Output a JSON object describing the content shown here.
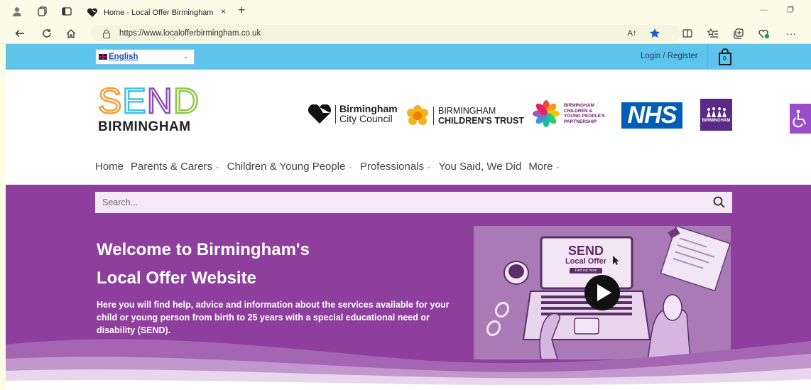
{
  "browser": {
    "tab_title": "Home - Local Offer Birmingham",
    "tab_close": "×",
    "new_tab": "+",
    "url": "https://www.localofferbirmingham.co.uk",
    "reader_label": "A↑"
  },
  "topstrip": {
    "language": "English",
    "login": "Login / Register",
    "cart_count": "0"
  },
  "logo": {
    "letters": [
      "S",
      "E",
      "N",
      "D"
    ],
    "letter_colors": [
      "#f29a2e",
      "#3dbfe6",
      "#8e4db8",
      "#8cc63f"
    ],
    "subtitle": "BIRMINGHAM"
  },
  "partners": {
    "bcc_line1": "Birmingham",
    "bcc_line2": "City Council",
    "bct_line1": "BIRMINGHAM",
    "bct_line2": "CHILDREN'S TRUST",
    "bcyp_lines": [
      "BIRMINGHAM",
      "CHILDREN &",
      "YOUNG PEOPLE'S",
      "PARTNERSHIP"
    ],
    "nhs": "NHS",
    "bpcf": "BIRMINGHAM"
  },
  "nav": {
    "items": [
      {
        "label": "Home",
        "dropdown": false
      },
      {
        "label": "Parents & Carers",
        "dropdown": true
      },
      {
        "label": "Children & Young People",
        "dropdown": true
      },
      {
        "label": "Professionals",
        "dropdown": true
      },
      {
        "label": "You Said, We Did",
        "dropdown": false
      },
      {
        "label": "More",
        "dropdown": true
      }
    ]
  },
  "hero": {
    "search_placeholder": "Search...",
    "title_line1": "Welcome to Birmingham's",
    "title_line2": "Local Offer Website",
    "intro": "Here you will find help, advice and information about the services available for your child or young person from birth to 25 years with a special educational need or disability (SEND).",
    "video_send": "SEND",
    "video_local_offer": "Local Offer",
    "video_find_out": "Find out more"
  },
  "colors": {
    "strip": "#5ec4ec",
    "hero": "#8e3f9e",
    "nhs": "#005eb8"
  }
}
